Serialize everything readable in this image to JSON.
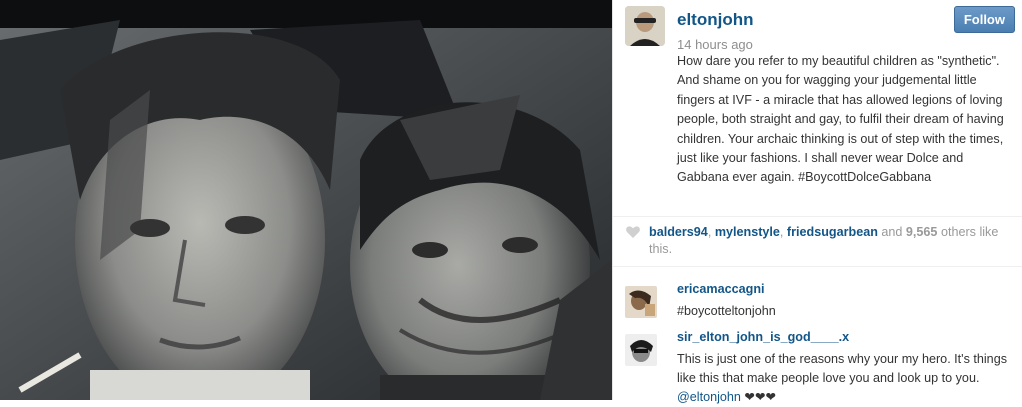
{
  "post": {
    "username": "eltonjohn",
    "time": "14 hours ago",
    "follow_label": "Follow",
    "caption": "How dare you refer to my beautiful children as \"synthetic\". And shame on you for wagging your judgemental little fingers at IVF - a miracle that has allowed legions of loving people, both straight and gay, to fulfil their dream of having children. Your archaic thinking is out of step with the times, just like your fashions. I shall never wear Dolce and Gabbana ever again. #BoycottDolceGabbana"
  },
  "likes": {
    "users": [
      "balders94",
      "mylenstyle",
      "friedsugarbean"
    ],
    "and": "and",
    "count": "9,565",
    "suffix": "others like this."
  },
  "comments": [
    {
      "username": "ericamaccagni",
      "text": "#boycotteltonjohn"
    },
    {
      "username": "sir_elton_john_is_god____.x",
      "text": "This is just one of the reasons why your my hero. It's things like this that make people love you and look up to you.",
      "mention": "@eltonjohn",
      "hearts": "❤❤❤"
    }
  ],
  "colors": {
    "link": "#125688",
    "follow_button": "#4a7fb2"
  },
  "icons": {
    "like": "heart-icon"
  }
}
